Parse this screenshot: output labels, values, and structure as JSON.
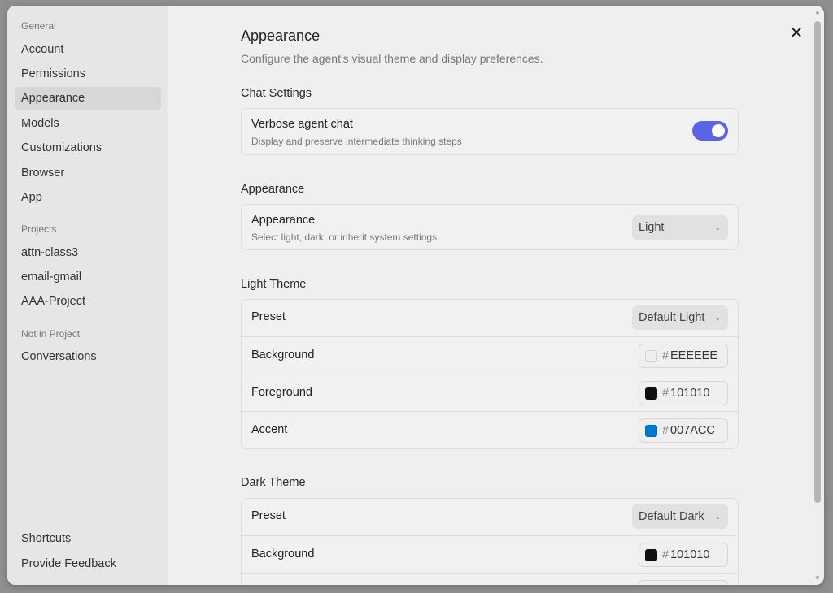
{
  "sidebar": {
    "sections": [
      {
        "label": "General"
      },
      {
        "label": "Projects"
      },
      {
        "label": "Not in Project"
      }
    ],
    "general_items": [
      "Account",
      "Permissions",
      "Appearance",
      "Models",
      "Customizations",
      "Browser",
      "App"
    ],
    "active_item": "Appearance",
    "project_items": [
      "attn-class3",
      "email-gmail",
      "AAA-Project"
    ],
    "other_items": [
      "Conversations"
    ],
    "footer_items": [
      "Shortcuts",
      "Provide Feedback"
    ]
  },
  "header": {
    "title": "Appearance",
    "subtitle": "Configure the agent's visual theme and display preferences.",
    "close_icon": "close-icon"
  },
  "chat_settings": {
    "title": "Chat Settings",
    "verbose_label": "Verbose agent chat",
    "verbose_desc": "Display and preserve intermediate thinking steps",
    "verbose_enabled": true,
    "toggle_color": "#5B63E6"
  },
  "appearance": {
    "title": "Appearance",
    "row_label": "Appearance",
    "row_desc": "Select light, dark, or inherit system settings.",
    "selected": "Light"
  },
  "light_theme": {
    "title": "Light Theme",
    "preset_label": "Preset",
    "preset_value": "Default Light",
    "background_label": "Background",
    "background_value": "EEEEEE",
    "background_color": "#EEEEEE",
    "foreground_label": "Foreground",
    "foreground_value": "101010",
    "foreground_color": "#101010",
    "accent_label": "Accent",
    "accent_value": "007ACC",
    "accent_color": "#007ACC"
  },
  "dark_theme": {
    "title": "Dark Theme",
    "preset_label": "Preset",
    "preset_value": "Default Dark",
    "background_label": "Background",
    "background_value": "101010",
    "background_color": "#101010"
  },
  "hash_symbol": "#"
}
